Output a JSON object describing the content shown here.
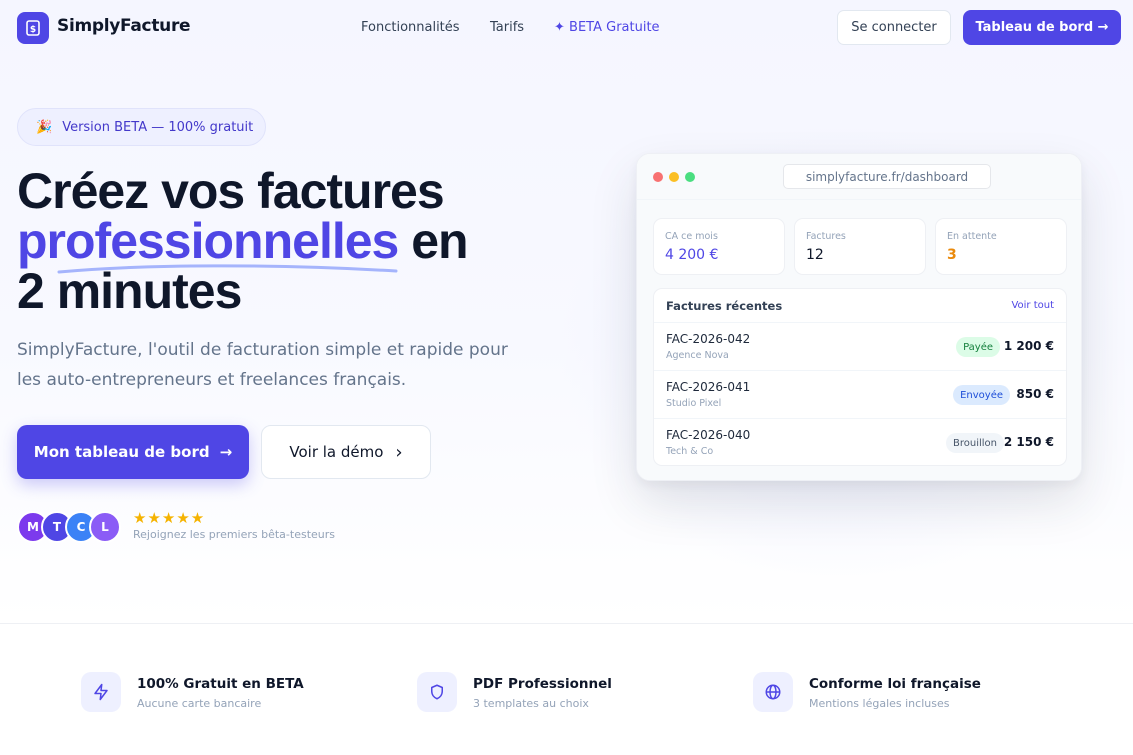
{
  "header": {
    "logo_text": "SimplyFacture",
    "nav": [
      {
        "label": "Fonctionnalités"
      },
      {
        "label": "Tarifs"
      },
      {
        "label": "✦ BETA Gratuite"
      }
    ],
    "login_label": "Se connecter",
    "dashboard_label": "Tableau de bord →"
  },
  "hero": {
    "badge_emoji": "🎉",
    "badge_text": "Version BETA — 100% gratuit",
    "title_line1": "Créez vos factures",
    "title_accent": "professionnelles",
    "title_mid": " en",
    "title_line3": "2 minutes",
    "subtitle": "SimplyFacture, l'outil de facturation simple et rapide pour les auto-entrepreneurs et freelances français.",
    "primary_cta": "Mon tableau de bord",
    "primary_cta_icon": "→",
    "secondary_cta": "Voir la démo",
    "secondary_cta_icon": "›",
    "avatars": [
      {
        "initial": "M",
        "color": "#7c3aed"
      },
      {
        "initial": "T",
        "color": "#4f46e5"
      },
      {
        "initial": "C",
        "color": "#3b82f6"
      },
      {
        "initial": "L",
        "color": "#8b5cf6"
      }
    ],
    "stars": "★★★★★",
    "social_proof": "Rejoignez les premiers bêta-testeurs"
  },
  "mockup": {
    "url": "simplyfacture.fr/dashboard",
    "window_dots": [
      "#f87171",
      "#fbbf24",
      "#4ade80"
    ],
    "stats": [
      {
        "label": "CA ce mois",
        "value": "4 200 €"
      },
      {
        "label": "Factures",
        "value": "12"
      },
      {
        "label": "En attente",
        "value": "3"
      }
    ],
    "recent_title": "Factures récentes",
    "recent_link": "Voir tout",
    "invoices": [
      {
        "number": "FAC-2026-042",
        "client": "Agence Nova",
        "status": "Payée",
        "amount": "1 200 €"
      },
      {
        "number": "FAC-2026-041",
        "client": "Studio Pixel",
        "status": "Envoyée",
        "amount": "850 €"
      },
      {
        "number": "FAC-2026-040",
        "client": "Tech & Co",
        "status": "Brouillon",
        "amount": "2 150 €"
      }
    ]
  },
  "features": [
    {
      "icon": "lightning-icon",
      "title": "100% Gratuit en BETA",
      "desc": "Aucune carte bancaire"
    },
    {
      "icon": "shield-icon",
      "title": "PDF Professionnel",
      "desc": "3 templates au choix"
    },
    {
      "icon": "globe-icon",
      "title": "Conforme loi française",
      "desc": "Mentions légales incluses"
    }
  ],
  "colors": {
    "brand": "#4f46e5",
    "text": "#0f172a",
    "muted": "#64748b",
    "pending": "#ea8a0c"
  }
}
